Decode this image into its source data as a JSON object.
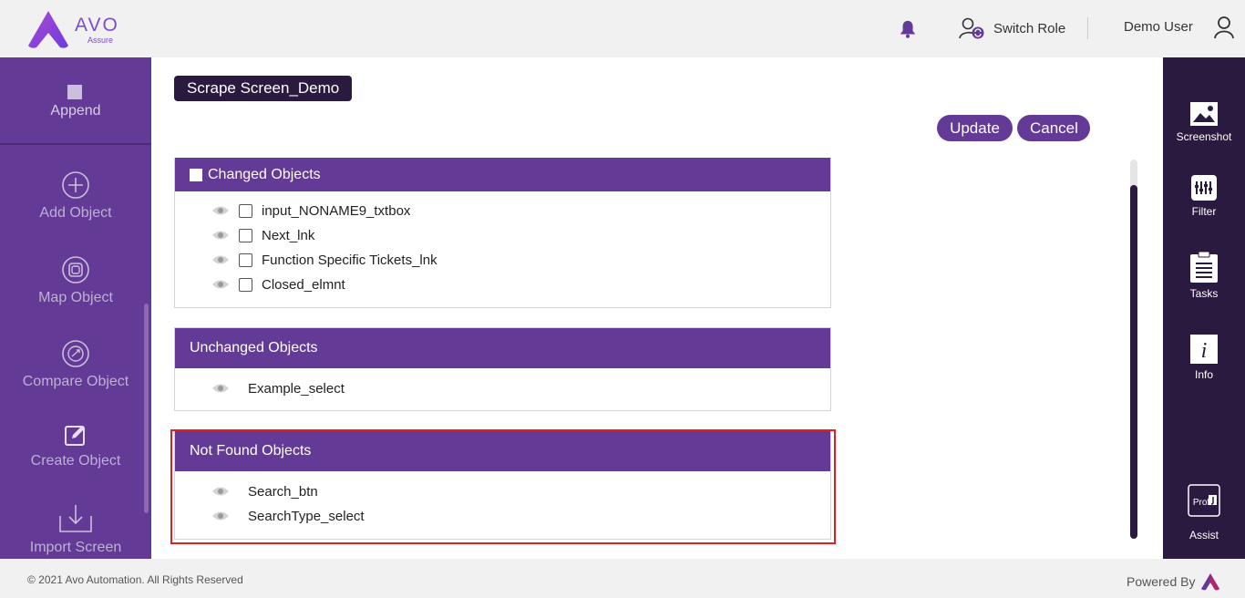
{
  "header": {
    "logo_text": "AVO",
    "logo_sub": "Assure",
    "switch_role": "Switch Role",
    "user_name": "Demo User"
  },
  "left_sidebar": {
    "append": "Append",
    "items": [
      {
        "label": "Add Object",
        "icon": "plus-circle-icon"
      },
      {
        "label": "Map Object",
        "icon": "map-object-icon"
      },
      {
        "label": "Compare Object",
        "icon": "compare-object-icon"
      },
      {
        "label": "Create Object",
        "icon": "create-object-icon"
      },
      {
        "label": "Import Screen",
        "icon": "import-screen-icon"
      }
    ]
  },
  "main": {
    "screen_title": "Scrape Screen_Demo",
    "update": "Update",
    "cancel": "Cancel",
    "changed": {
      "title": "Changed Objects",
      "items": [
        "input_NONAME9_txtbox",
        "Next_lnk",
        "Function Specific Tickets_lnk",
        "Closed_elmnt"
      ]
    },
    "unchanged": {
      "title": "Unchanged Objects",
      "items": [
        "Example_select"
      ]
    },
    "not_found": {
      "title": "Not Found Objects",
      "items": [
        "Search_btn",
        "SearchType_select"
      ]
    }
  },
  "right_sidebar": {
    "items": [
      {
        "label": "Screenshot",
        "icon": "screenshot-icon"
      },
      {
        "label": "Filter",
        "icon": "filter-icon"
      },
      {
        "label": "Tasks",
        "icon": "tasks-icon"
      },
      {
        "label": "Info",
        "icon": "info-icon"
      },
      {
        "label": "Assist",
        "icon": "assist-icon",
        "badge": "Prof"
      }
    ]
  },
  "footer": {
    "copyright": "© 2021 Avo Automation. All Rights Reserved",
    "powered_by": "Powered By"
  },
  "colors": {
    "primary": "#633a95",
    "dark": "#2b1a3f",
    "highlight": "#e02020"
  }
}
